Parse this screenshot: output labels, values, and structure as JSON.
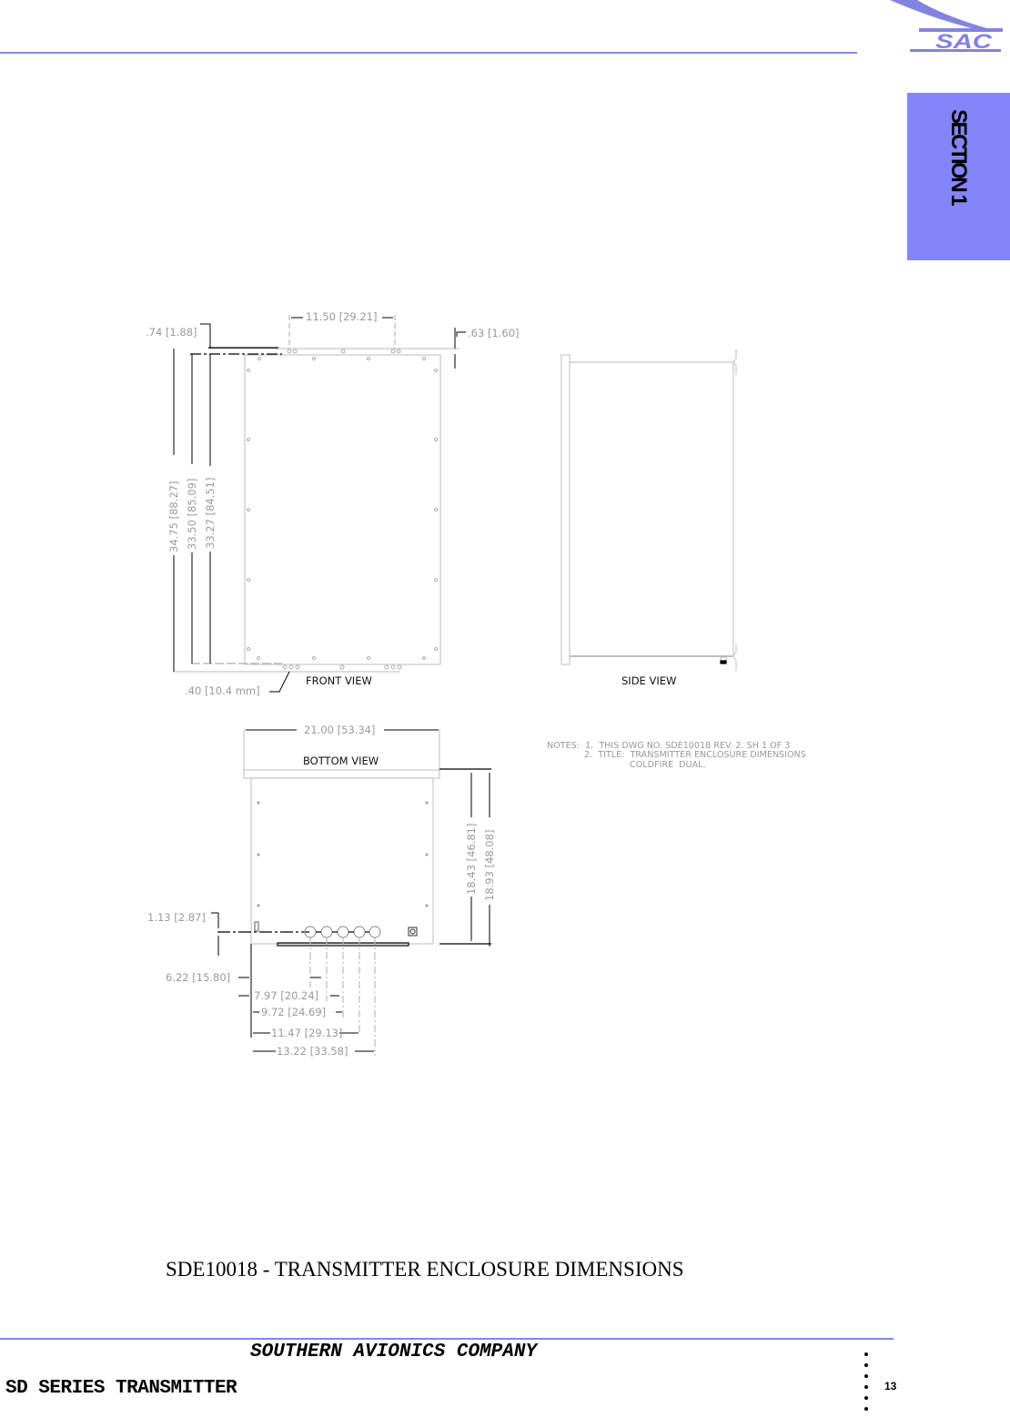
{
  "header": {
    "logo_text": "SAC",
    "section_tab": "SECTION 1",
    "accent_color": "#8585f5",
    "tab_color": "#8484fb"
  },
  "drawing": {
    "front_view": {
      "label": "FRONT VIEW",
      "dims": {
        "top_width": "11.50 [29.21]",
        "left_offset": ".74 [1.88]",
        "right_offset": ".63 [1.60]",
        "height_overall": "34.75 [88.27]",
        "height_mid": "33.50 [85.09]",
        "height_inner": "33.27 [84.51]",
        "bottom_hole": ".40 [10.4 mm]"
      }
    },
    "side_view": {
      "label": "SIDE VIEW"
    },
    "bottom_view": {
      "label": "BOTTOM VIEW",
      "dims": {
        "width": "21.00 [53.34]",
        "depth_inner": "18.43 [46.81]",
        "depth_overall": "18.93 [48.08]",
        "centerline_offset": "1.13 [2.87]",
        "hole_1": "6.22 [15.80]",
        "hole_2": "7.97 [20.24]",
        "hole_3": "9.72 [24.69]",
        "hole_4": "11.47 [29.13]",
        "hole_5": "13.22 [33.58]"
      }
    },
    "notes": {
      "line1": "NOTES:  1.  THIS DWG NO. SDE10018 REV. 2. SH 1 OF 3",
      "line2": "2.  TITLE:  TRANSMITTER ENCLOSURE DIMENSIONS",
      "line3": "COLDFIRE  DUAL."
    }
  },
  "caption": "SDE10018 - TRANSMITTER ENCLOSURE DIMENSIONS",
  "footer": {
    "company": "SOUTHERN AVIONICS COMPANY",
    "product": "SD SERIES TRANSMITTER",
    "page_number": "13"
  }
}
